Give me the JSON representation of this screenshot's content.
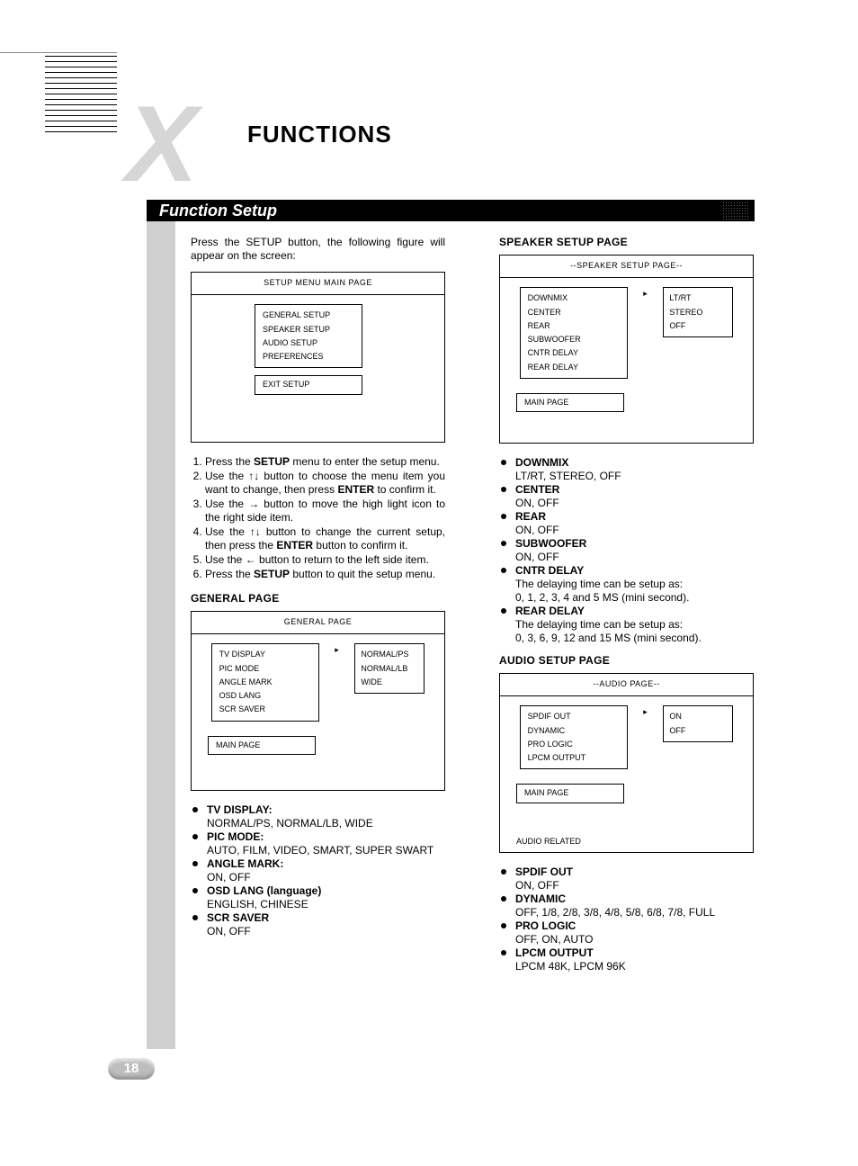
{
  "page_number": "18",
  "chapter_title": "FUNCTIONS",
  "section_title": "Function Setup",
  "intro": "Press the SETUP button, the following figure will appear on the screen:",
  "setup_menu_box": {
    "title": "SETUP MENU   MAIN PAGE",
    "items": [
      "GENERAL SETUP",
      "SPEAKER SETUP",
      "AUDIO SETUP",
      "PREFERENCES"
    ],
    "exit": "EXIT SETUP"
  },
  "steps": [
    "Press the <b>SETUP</b> menu to enter the setup menu.",
    "Use the ↑↓ button to choose the menu item you want to change, then press <b>ENTER</b> to confirm it.",
    "Use the → button to move the high light icon to the right side item.",
    "Use the ↑↓ button to change the current setup, then press the <b>ENTER</b> button to confirm it.",
    "Use the ← button to return to the left side item.",
    "Press the <b>SETUP</b> button to quit the setup menu."
  ],
  "general_page": {
    "heading": "GENERAL PAGE",
    "box_title": "GENERAL PAGE",
    "left_items": [
      "TV DISPLAY",
      "PIC MODE",
      "ANGLE MARK",
      "OSD LANG",
      "SCR SAVER"
    ],
    "right_items": [
      "NORMAL/PS",
      "NORMAL/LB",
      "WIDE"
    ],
    "main_page": "MAIN PAGE",
    "bullets": [
      {
        "label": "TV DISPLAY:",
        "value": "NORMAL/PS, NORMAL/LB, WIDE"
      },
      {
        "label": "PIC MODE:",
        "value": "AUTO, FILM, VIDEO, SMART, SUPER SWART"
      },
      {
        "label": "ANGLE MARK:",
        "value": "ON, OFF"
      },
      {
        "label": "OSD LANG (language)",
        "value": "ENGLISH, CHINESE"
      },
      {
        "label": "SCR SAVER",
        "value": "ON, OFF"
      }
    ]
  },
  "speaker_page": {
    "heading": "SPEAKER SETUP PAGE",
    "box_title": "--SPEAKER SETUP PAGE--",
    "left_items": [
      "DOWNMIX",
      "CENTER",
      "REAR",
      "SUBWOOFER",
      "CNTR DELAY",
      "REAR DELAY"
    ],
    "right_items": [
      "LT/RT",
      "STEREO",
      "OFF"
    ],
    "main_page": "MAIN PAGE",
    "bullets": [
      {
        "label": "DOWNMIX",
        "value": "LT/RT, STEREO, OFF"
      },
      {
        "label": "CENTER",
        "value": "ON, OFF"
      },
      {
        "label": "REAR",
        "value": "ON, OFF"
      },
      {
        "label": "SUBWOOFER",
        "value": "ON, OFF"
      },
      {
        "label": "CNTR DELAY",
        "value": "The delaying time can be setup as:\n0, 1, 2, 3, 4 and 5 MS (mini second)."
      },
      {
        "label": "REAR DELAY",
        "value": "The delaying time can be setup as:\n0, 3, 6, 9, 12 and 15 MS (mini second)."
      }
    ]
  },
  "audio_page": {
    "heading": "AUDIO SETUP PAGE",
    "box_title": "--AUDIO PAGE--",
    "left_items": [
      "SPDIF OUT",
      "DYNAMIC",
      "PRO LOGIC",
      "LPCM OUTPUT"
    ],
    "right_items": [
      "ON",
      "OFF"
    ],
    "main_page": "MAIN PAGE",
    "footer": "AUDIO RELATED",
    "bullets": [
      {
        "label": "SPDIF OUT",
        "value": "ON, OFF"
      },
      {
        "label": "DYNAMIC",
        "value": "OFF, 1/8, 2/8, 3/8, 4/8, 5/8, 6/8, 7/8, FULL"
      },
      {
        "label": "PRO LOGIC",
        "value": "OFF, ON, AUTO"
      },
      {
        "label": "LPCM OUTPUT",
        "value": "LPCM 48K, LPCM 96K"
      }
    ]
  }
}
